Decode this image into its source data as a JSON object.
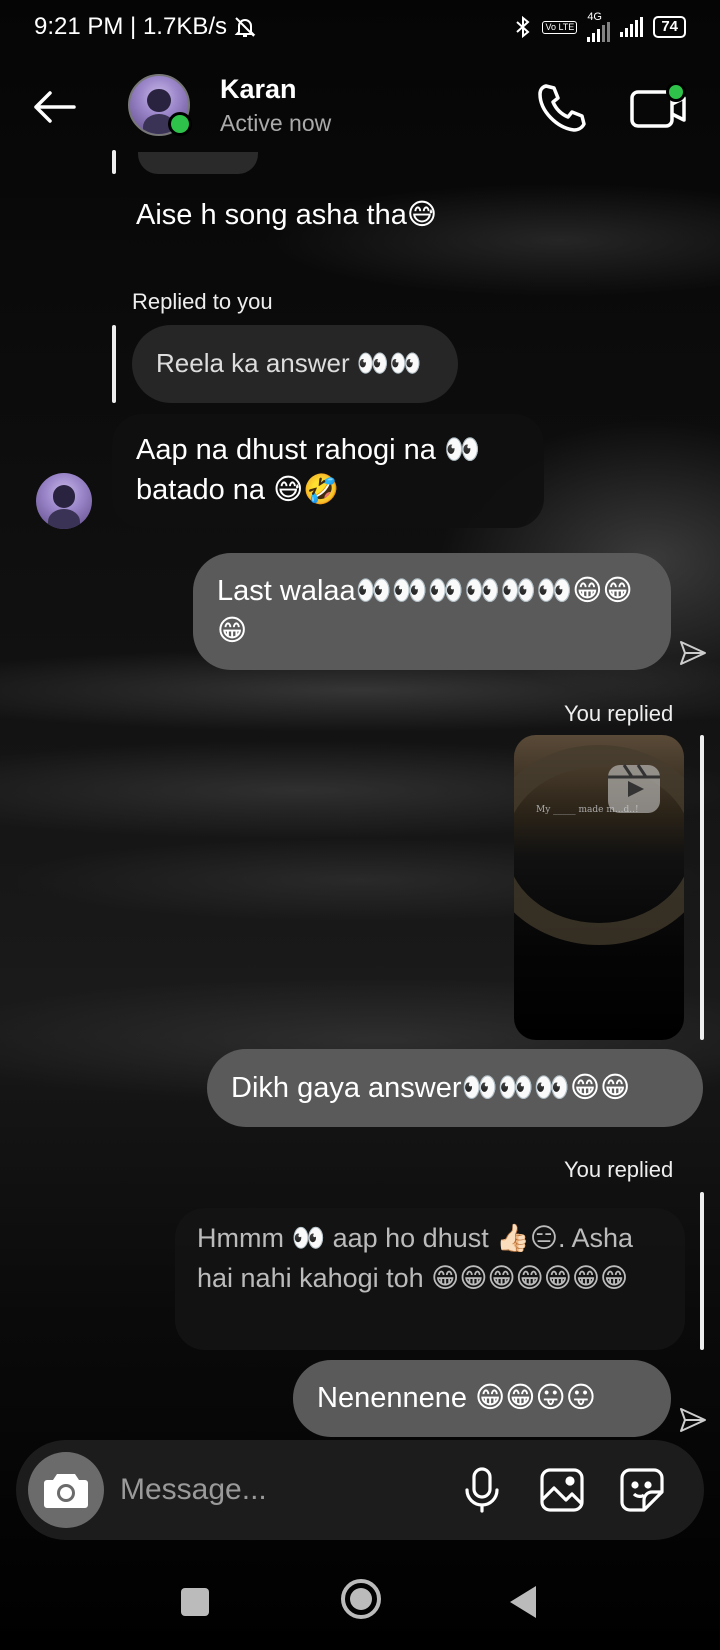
{
  "status_bar": {
    "time_speed": "9:21 PM | 1.7KB/s",
    "network": "4G",
    "volte": "Vo LTE",
    "battery": "74"
  },
  "header": {
    "name": "Karan",
    "status": "Active now"
  },
  "messages": {
    "m1": "Aise h song asha tha😅",
    "m2_reply_label": "Replied to you",
    "m2_quote": "Reela ka answer 👀👀",
    "m3": "Aap na dhust rahogi na 👀 batado na 😅🤣",
    "m4": "Last walaa👀👀👀👀👀👀😁😁😁",
    "m5_reply_label": "You replied",
    "m5_reel_caption": "My _____ made m...d..!",
    "m6": "Dikh gaya answer👀👀👀😁😁",
    "m7_reply_label": "You replied",
    "m7_quote": "Hmmm 👀 aap ho dhust 👍🏻😑. Asha hai nahi kahogi toh 😁😁😁😁😁😁😁",
    "m8": "Nenennene 😁😁😛😛"
  },
  "composer": {
    "placeholder": "Message..."
  },
  "icons": {
    "back": "arrow-left-icon",
    "call": "phone-icon",
    "video": "video-camera-icon",
    "camera": "camera-icon",
    "mic": "microphone-icon",
    "gallery": "image-icon",
    "sticker": "sticker-icon",
    "sent": "paper-plane-icon"
  },
  "colors": {
    "online": "#2ec24b",
    "sent_bubble": "#5a5a5a",
    "received_bubble": "#1e1e1e"
  }
}
